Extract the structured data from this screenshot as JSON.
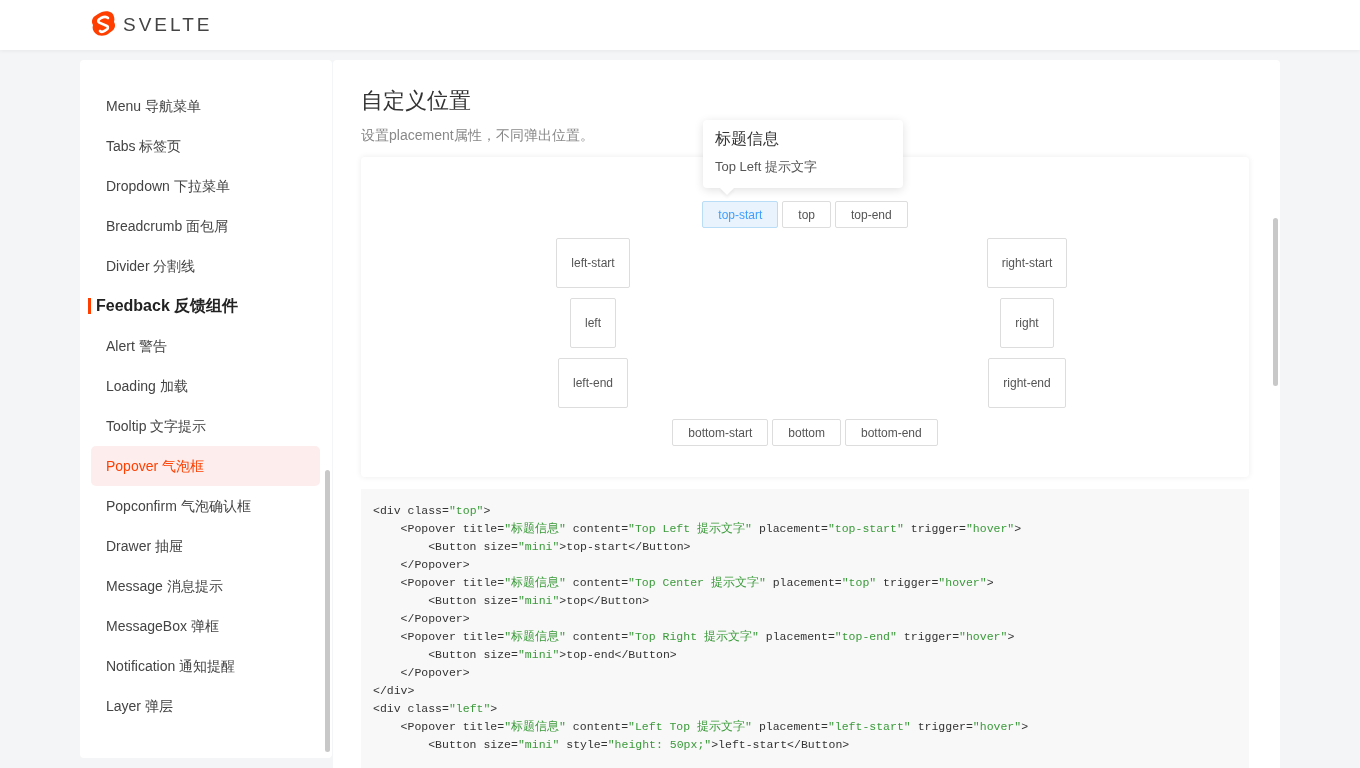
{
  "header": {
    "logo_text": "SVELTE"
  },
  "sidebar": {
    "items": [
      {
        "kind": "item",
        "label": "Menu 导航菜单",
        "selected": false
      },
      {
        "kind": "item",
        "label": "Tabs 标签页",
        "selected": false
      },
      {
        "kind": "item",
        "label": "Dropdown 下拉菜单",
        "selected": false
      },
      {
        "kind": "item",
        "label": "Breadcrumb 面包屑",
        "selected": false
      },
      {
        "kind": "item",
        "label": "Divider 分割线",
        "selected": false
      },
      {
        "kind": "group",
        "label": "Feedback 反馈组件"
      },
      {
        "kind": "item",
        "label": "Alert 警告",
        "selected": false
      },
      {
        "kind": "item",
        "label": "Loading 加载",
        "selected": false
      },
      {
        "kind": "item",
        "label": "Tooltip 文字提示",
        "selected": false
      },
      {
        "kind": "item",
        "label": "Popover 气泡框",
        "selected": true
      },
      {
        "kind": "item",
        "label": "Popconfirm 气泡确认框",
        "selected": false
      },
      {
        "kind": "item",
        "label": "Drawer 抽屉",
        "selected": false
      },
      {
        "kind": "item",
        "label": "Message 消息提示",
        "selected": false
      },
      {
        "kind": "item",
        "label": "MessageBox 弹框",
        "selected": false
      },
      {
        "kind": "item",
        "label": "Notification 通知提醒",
        "selected": false
      },
      {
        "kind": "item",
        "label": "Layer 弹层",
        "selected": false
      }
    ]
  },
  "content": {
    "title": "自定义位置",
    "description": "设置placement属性，不同弹出位置。",
    "popover": {
      "title": "标题信息",
      "content": "Top Left 提示文字"
    },
    "buttons": {
      "top": [
        {
          "label": "top-start",
          "selected": true
        },
        {
          "label": "top",
          "selected": false
        },
        {
          "label": "top-end",
          "selected": false
        }
      ],
      "left": [
        {
          "label": "left-start",
          "selected": false
        },
        {
          "label": "left",
          "selected": false
        },
        {
          "label": "left-end",
          "selected": false
        }
      ],
      "right": [
        {
          "label": "right-start",
          "selected": false
        },
        {
          "label": "right",
          "selected": false
        },
        {
          "label": "right-end",
          "selected": false
        }
      ],
      "bottom": [
        {
          "label": "bottom-start",
          "selected": false
        },
        {
          "label": "bottom",
          "selected": false
        },
        {
          "label": "bottom-end",
          "selected": false
        }
      ]
    },
    "code": [
      [
        {
          "kind": "plain",
          "text": "<div class="
        },
        {
          "kind": "string",
          "text": "\"top\""
        },
        {
          "kind": "plain",
          "text": ">"
        }
      ],
      [
        {
          "kind": "plain",
          "text": "    <Popover title="
        },
        {
          "kind": "string",
          "text": "\"标题信息\""
        },
        {
          "kind": "plain",
          "text": " content="
        },
        {
          "kind": "string",
          "text": "\"Top Left 提示文字\""
        },
        {
          "kind": "plain",
          "text": " placement="
        },
        {
          "kind": "string",
          "text": "\"top-start\""
        },
        {
          "kind": "plain",
          "text": " trigger="
        },
        {
          "kind": "string",
          "text": "\"hover\""
        },
        {
          "kind": "plain",
          "text": ">"
        }
      ],
      [
        {
          "kind": "plain",
          "text": "        <Button size="
        },
        {
          "kind": "string",
          "text": "\"mini\""
        },
        {
          "kind": "plain",
          "text": ">top-start</Button>"
        }
      ],
      [
        {
          "kind": "plain",
          "text": "    </Popover>"
        }
      ],
      [
        {
          "kind": "plain",
          "text": "    <Popover title="
        },
        {
          "kind": "string",
          "text": "\"标题信息\""
        },
        {
          "kind": "plain",
          "text": " content="
        },
        {
          "kind": "string",
          "text": "\"Top Center 提示文字\""
        },
        {
          "kind": "plain",
          "text": " placement="
        },
        {
          "kind": "string",
          "text": "\"top\""
        },
        {
          "kind": "plain",
          "text": " trigger="
        },
        {
          "kind": "string",
          "text": "\"hover\""
        },
        {
          "kind": "plain",
          "text": ">"
        }
      ],
      [
        {
          "kind": "plain",
          "text": "        <Button size="
        },
        {
          "kind": "string",
          "text": "\"mini\""
        },
        {
          "kind": "plain",
          "text": ">top</Button>"
        }
      ],
      [
        {
          "kind": "plain",
          "text": "    </Popover>"
        }
      ],
      [
        {
          "kind": "plain",
          "text": "    <Popover title="
        },
        {
          "kind": "string",
          "text": "\"标题信息\""
        },
        {
          "kind": "plain",
          "text": " content="
        },
        {
          "kind": "string",
          "text": "\"Top Right 提示文字\""
        },
        {
          "kind": "plain",
          "text": " placement="
        },
        {
          "kind": "string",
          "text": "\"top-end\""
        },
        {
          "kind": "plain",
          "text": " trigger="
        },
        {
          "kind": "string",
          "text": "\"hover\""
        },
        {
          "kind": "plain",
          "text": ">"
        }
      ],
      [
        {
          "kind": "plain",
          "text": "        <Button size="
        },
        {
          "kind": "string",
          "text": "\"mini\""
        },
        {
          "kind": "plain",
          "text": ">top-end</Button>"
        }
      ],
      [
        {
          "kind": "plain",
          "text": "    </Popover>"
        }
      ],
      [
        {
          "kind": "plain",
          "text": "</div>"
        }
      ],
      [
        {
          "kind": "plain",
          "text": "<div class="
        },
        {
          "kind": "string",
          "text": "\"left\""
        },
        {
          "kind": "plain",
          "text": ">"
        }
      ],
      [
        {
          "kind": "plain",
          "text": "    <Popover title="
        },
        {
          "kind": "string",
          "text": "\"标题信息\""
        },
        {
          "kind": "plain",
          "text": " content="
        },
        {
          "kind": "string",
          "text": "\"Left Top 提示文字\""
        },
        {
          "kind": "plain",
          "text": " placement="
        },
        {
          "kind": "string",
          "text": "\"left-start\""
        },
        {
          "kind": "plain",
          "text": " trigger="
        },
        {
          "kind": "string",
          "text": "\"hover\""
        },
        {
          "kind": "plain",
          "text": ">"
        }
      ],
      [
        {
          "kind": "plain",
          "text": "        <Button size="
        },
        {
          "kind": "string",
          "text": "\"mini\""
        },
        {
          "kind": "plain",
          "text": " style="
        },
        {
          "kind": "string",
          "text": "\"height: 50px;\""
        },
        {
          "kind": "plain",
          "text": ">left-start</Button>"
        }
      ]
    ]
  }
}
